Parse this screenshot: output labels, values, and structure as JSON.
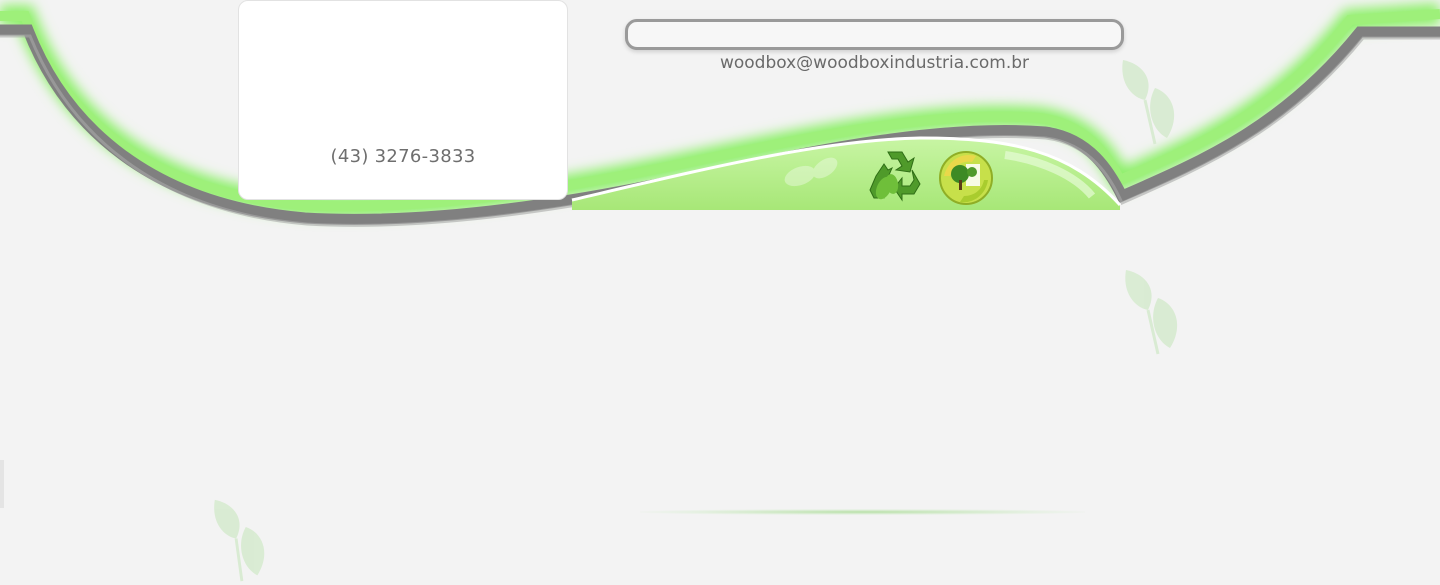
{
  "header": {
    "phone": "(43) 3276-3833",
    "email": "woodbox@woodboxindustria.com.br",
    "search": {
      "placeholder": "",
      "value": ""
    }
  },
  "colors": {
    "background": "#f3f3f3",
    "accent_green": "#7fe85a",
    "band_gray": "#7a7a7a",
    "panel_green": "#b9ef8c"
  },
  "icons": [
    "recycle-icon",
    "earth-tree-icon",
    "leaf-icon"
  ]
}
